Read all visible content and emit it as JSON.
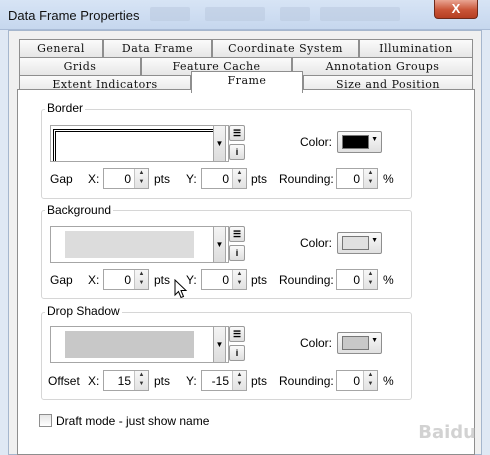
{
  "window": {
    "title": "Data Frame Properties",
    "close_label": "X"
  },
  "tabs": {
    "row1": [
      "General",
      "Data Frame",
      "Coordinate System",
      "Illumination"
    ],
    "row2": [
      "Grids",
      "Feature Cache",
      "Annotation Groups"
    ],
    "row3": [
      "Extent Indicators",
      "Frame",
      "Size and Position"
    ],
    "active": "Frame"
  },
  "border": {
    "label": "Border",
    "color_label": "Color:",
    "color": "#000000",
    "gap_label": "Gap",
    "x_label": "X:",
    "x_value": "0",
    "y_label": "Y:",
    "y_value": "0",
    "units": "pts",
    "rounding_label": "Rounding:",
    "rounding_value": "0",
    "percent": "%"
  },
  "background": {
    "label": "Background",
    "color_label": "Color:",
    "color": "#e0e0e0",
    "gap_label": "Gap",
    "x_label": "X:",
    "x_value": "0",
    "y_label": "Y:",
    "y_value": "0",
    "units": "pts",
    "rounding_label": "Rounding:",
    "rounding_value": "0",
    "percent": "%"
  },
  "drop_shadow": {
    "label": "Drop Shadow",
    "color_label": "Color:",
    "color": "#c8c8c8",
    "offset_label": "Offset",
    "x_label": "X:",
    "x_value": "15",
    "y_label": "Y:",
    "y_value": "-15",
    "units": "pts",
    "rounding_label": "Rounding:",
    "rounding_value": "0",
    "percent": "%"
  },
  "draft_mode": {
    "label": "Draft mode - just show name",
    "checked": false
  },
  "icons": {
    "dropdown": "triangle-down",
    "symbol_selector": "list-icon",
    "properties": "info-icon",
    "spin": "up-down-arrows",
    "cursor": "mouse-pointer"
  },
  "watermark": "Baidu"
}
